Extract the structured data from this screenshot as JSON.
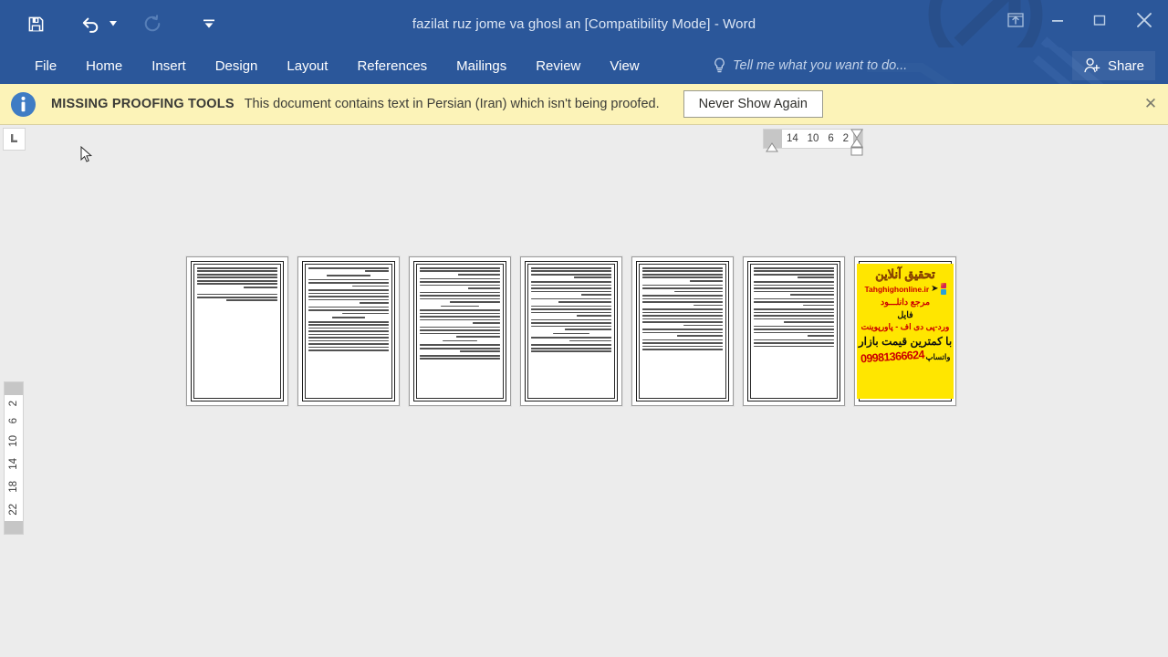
{
  "window": {
    "title": "fazilat ruz jome va ghosl an [Compatibility Mode] - Word",
    "quick_access": [
      {
        "name": "save",
        "label": "Save",
        "icon": "floppy-disk-icon"
      },
      {
        "name": "undo",
        "label": "Undo",
        "icon": "undo-arrow-icon",
        "has_dropdown": true
      },
      {
        "name": "redo",
        "label": "Repeat",
        "icon": "redo-circular-arrow-icon",
        "disabled": true
      },
      {
        "name": "customize",
        "label": "Customize Quick Access Toolbar",
        "icon": "chevron-down-icon"
      }
    ],
    "controls": [
      {
        "name": "ribbon-display-options",
        "label": "Ribbon Display Options",
        "icon": "ribbon-display-icon"
      },
      {
        "name": "minimize",
        "label": "Minimize",
        "icon": "minimize-icon"
      },
      {
        "name": "restore",
        "label": "Restore Down",
        "icon": "restore-icon"
      },
      {
        "name": "close",
        "label": "Close",
        "icon": "close-x-icon"
      }
    ],
    "titlebar_color": "#2b579a"
  },
  "ribbon": {
    "tabs": [
      {
        "label": "File"
      },
      {
        "label": "Home"
      },
      {
        "label": "Insert"
      },
      {
        "label": "Design"
      },
      {
        "label": "Layout"
      },
      {
        "label": "References"
      },
      {
        "label": "Mailings"
      },
      {
        "label": "Review"
      },
      {
        "label": "View"
      }
    ],
    "tell_me_placeholder": "Tell me what you want to do...",
    "share_label": "Share"
  },
  "notification": {
    "title": "MISSING PROOFING TOOLS",
    "message": "This document contains text in Persian (Iran) which isn't being proofed.",
    "action_label": "Never Show Again",
    "close_label": "✕",
    "background_color": "#fcf3b8"
  },
  "rulers": {
    "tab_selector_glyph": "┗",
    "horizontal_ticks": [
      "14",
      "10",
      "6",
      "2"
    ],
    "vertical_ticks": [
      "2",
      "2",
      "6",
      "10",
      "14",
      "18",
      "22"
    ]
  },
  "document": {
    "zoom_view": "multiple-pages",
    "page_count": 7,
    "pages": [
      {
        "index": 1,
        "type": "text",
        "paragraph_line_counts": [
          7,
          3
        ]
      },
      {
        "index": 2,
        "type": "text",
        "paragraph_line_counts": [
          2,
          1,
          3,
          2,
          5,
          3,
          1,
          10
        ]
      },
      {
        "index": 3,
        "type": "text",
        "paragraph_line_counts": [
          3,
          4,
          4,
          1,
          5,
          4,
          1,
          3,
          2
        ]
      },
      {
        "index": 4,
        "type": "text",
        "paragraph_line_counts": [
          4,
          5,
          2,
          4,
          4,
          1,
          2,
          3
        ]
      },
      {
        "index": 5,
        "type": "text",
        "paragraph_line_counts": [
          5,
          3,
          4,
          6,
          3,
          4
        ]
      },
      {
        "index": 6,
        "type": "text",
        "paragraph_line_counts": [
          4,
          5,
          3,
          5,
          4,
          3
        ]
      },
      {
        "index": 7,
        "type": "advertisement"
      }
    ],
    "advertisement": {
      "title": "تحقیق آنلاین",
      "url": "Tahghighonline.ir",
      "line_reference": "مرجع دانلـــود",
      "line_file": "فایل",
      "line_formats": "ورد-پی دی اف - پاورپوینت",
      "line_price": "با کمترین قیمت بازار",
      "whatsapp_label": "واتساپ",
      "phone": "09981366624",
      "background_color": "#ffe600",
      "title_color": "#e8710a",
      "accent_color": "#cc0000"
    }
  }
}
